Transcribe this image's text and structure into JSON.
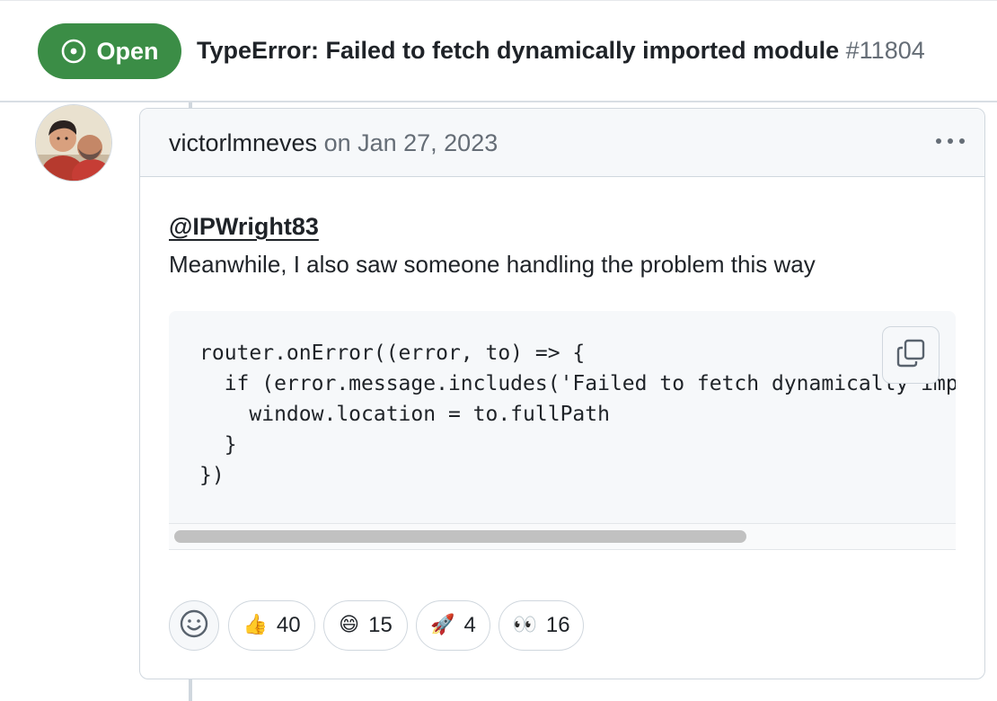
{
  "issue": {
    "status_label": "Open",
    "title": "TypeError: Failed to fetch dynamically imported module",
    "number": "#11804"
  },
  "comment": {
    "author": "victorlmneves",
    "date_text": "on Jan 27, 2023",
    "mention": "@IPWright83",
    "body": "Meanwhile, I also saw someone handling the problem this way",
    "code_lines": [
      "router.onError((error, to) => {",
      "  if (error.message.includes('Failed to fetch dynamically imported module')) {",
      "    window.location = to.fullPath",
      "  }",
      "})"
    ]
  },
  "reactions": [
    {
      "icon": "thumbs-up-icon",
      "emoji": "👍",
      "count": "40"
    },
    {
      "icon": "smile-icon",
      "emoji": "😄",
      "count": "15"
    },
    {
      "icon": "rocket-icon",
      "emoji": "🚀",
      "count": "4"
    },
    {
      "icon": "eyes-icon",
      "emoji": "👀",
      "count": "16"
    }
  ],
  "colors": {
    "open_green": "#3b8d46",
    "muted_text": "#656d76",
    "border": "#d0d7de",
    "code_bg": "#f6f8fa"
  }
}
